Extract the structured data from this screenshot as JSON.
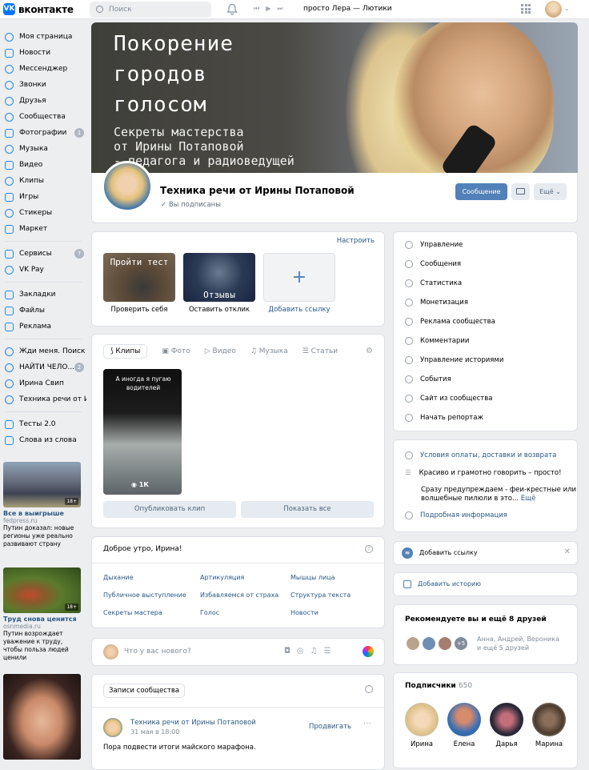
{
  "topbar": {
    "logo_text": "вконтакте",
    "search_placeholder": "Поиск",
    "now_playing": "просто Лера — Лютики"
  },
  "nav": {
    "items": [
      {
        "label": "Моя страница"
      },
      {
        "label": "Новости"
      },
      {
        "label": "Мессенджер"
      },
      {
        "label": "Звонки"
      },
      {
        "label": "Друзья"
      },
      {
        "label": "Сообщества"
      },
      {
        "label": "Фотографии",
        "badge": "1"
      },
      {
        "label": "Музыка"
      },
      {
        "label": "Видео"
      },
      {
        "label": "Клипы"
      },
      {
        "label": "Игры"
      },
      {
        "label": "Стикеры"
      },
      {
        "label": "Маркет"
      }
    ],
    "items2": [
      {
        "label": "Сервисы",
        "badge": "7"
      },
      {
        "label": "VK Pay"
      }
    ],
    "items3": [
      {
        "label": "Закладки"
      },
      {
        "label": "Файлы"
      },
      {
        "label": "Реклама"
      }
    ],
    "items4": [
      {
        "label": "Жди меня. Поиск ..."
      },
      {
        "label": "НАЙТИ ЧЕЛО...",
        "badge": "2"
      },
      {
        "label": "Ирина Свип"
      },
      {
        "label": "Техника речи от И..."
      }
    ],
    "items5": [
      {
        "label": "Тесты 2.0"
      },
      {
        "label": "Слова из слова"
      }
    ]
  },
  "ads": [
    {
      "title": "Все в выигрыше",
      "domain": "fedpress.ru",
      "text": "Путин доказал: новые регионы уже реально развивают страну",
      "age": "18+"
    },
    {
      "title": "Труд снова ценится",
      "domain": "osnmedia.ru",
      "text": "Путин возрождает уважение к труду, чтобы польза людей ценили",
      "age": "18+"
    }
  ],
  "cover": {
    "heading": [
      "Покорение",
      "городов",
      "голосом"
    ],
    "sub": [
      "Секреты мастерства",
      "от Ирины Потаповой",
      "- педагога и радиоведущей"
    ]
  },
  "group": {
    "title": "Техника речи от Ирины Потаповой",
    "status": "Вы подписаны",
    "message_button": "Сообщение",
    "more_button": "Ещё"
  },
  "links": {
    "settings": "Настроить",
    "tiles": [
      {
        "title": "Пройти тест",
        "label": "Проверить себя"
      },
      {
        "title": "Отзывы",
        "label": "Оставить отклик"
      },
      {
        "label": "Добавить ссылку"
      }
    ]
  },
  "clips": {
    "tabs": [
      "Клипы",
      "Фото",
      "Видео",
      "Музыка",
      "Статьи"
    ],
    "clip_caption": "А иногда я пугаю водителей",
    "clip_views": "1К",
    "publish_button": "Опубликовать клип",
    "show_all_button": "Показать все"
  },
  "greeting": {
    "title": "Доброе утро, Ирина!",
    "links": [
      "Дыхание",
      "Артикуляция",
      "Мышцы лица",
      "Публичное выступление",
      "Избавляемся от страха",
      "Структура текста",
      "Секреты мастера",
      "Голос",
      "Новости"
    ]
  },
  "composer": {
    "placeholder": "Что у вас нового?"
  },
  "wall": {
    "tab": "Записи сообщества",
    "author": "Техника речи от Ирины Потаповой",
    "date": "31 мая в 18:00",
    "promote": "Продвигать",
    "text": "Пора подвести итоги майского марафона."
  },
  "admin_menu": [
    "Управление",
    "Сообщения",
    "Статистика",
    "Монетизация",
    "Реклама сообщества",
    "Комментарии",
    "Управление историями",
    "События",
    "Сайт из сообщества",
    "Начать репортаж"
  ],
  "info": {
    "payment": "Условия оплаты, доставки и возврата",
    "slogan": "Красиво и грамотно говорить – просто!",
    "desc_line1": "Сразу предупреждаем - феи-крестные или",
    "desc_line2": "волшебные пилюли в это...",
    "more": "Ещё",
    "details": "Подробная информация"
  },
  "add_link": "Добавить ссылку",
  "add_story": "Добавить историю",
  "friends": {
    "title": "Рекомендуете вы и ещё 8 друзей",
    "extra": "+5",
    "names_line1": "Анна, Андрей, Вероника",
    "names_line2": "и ещё 5 друзей"
  },
  "subscribers": {
    "title": "Подписчики",
    "count": "650",
    "people": [
      "Ирина",
      "Елена",
      "Дарья",
      "Марина"
    ]
  }
}
